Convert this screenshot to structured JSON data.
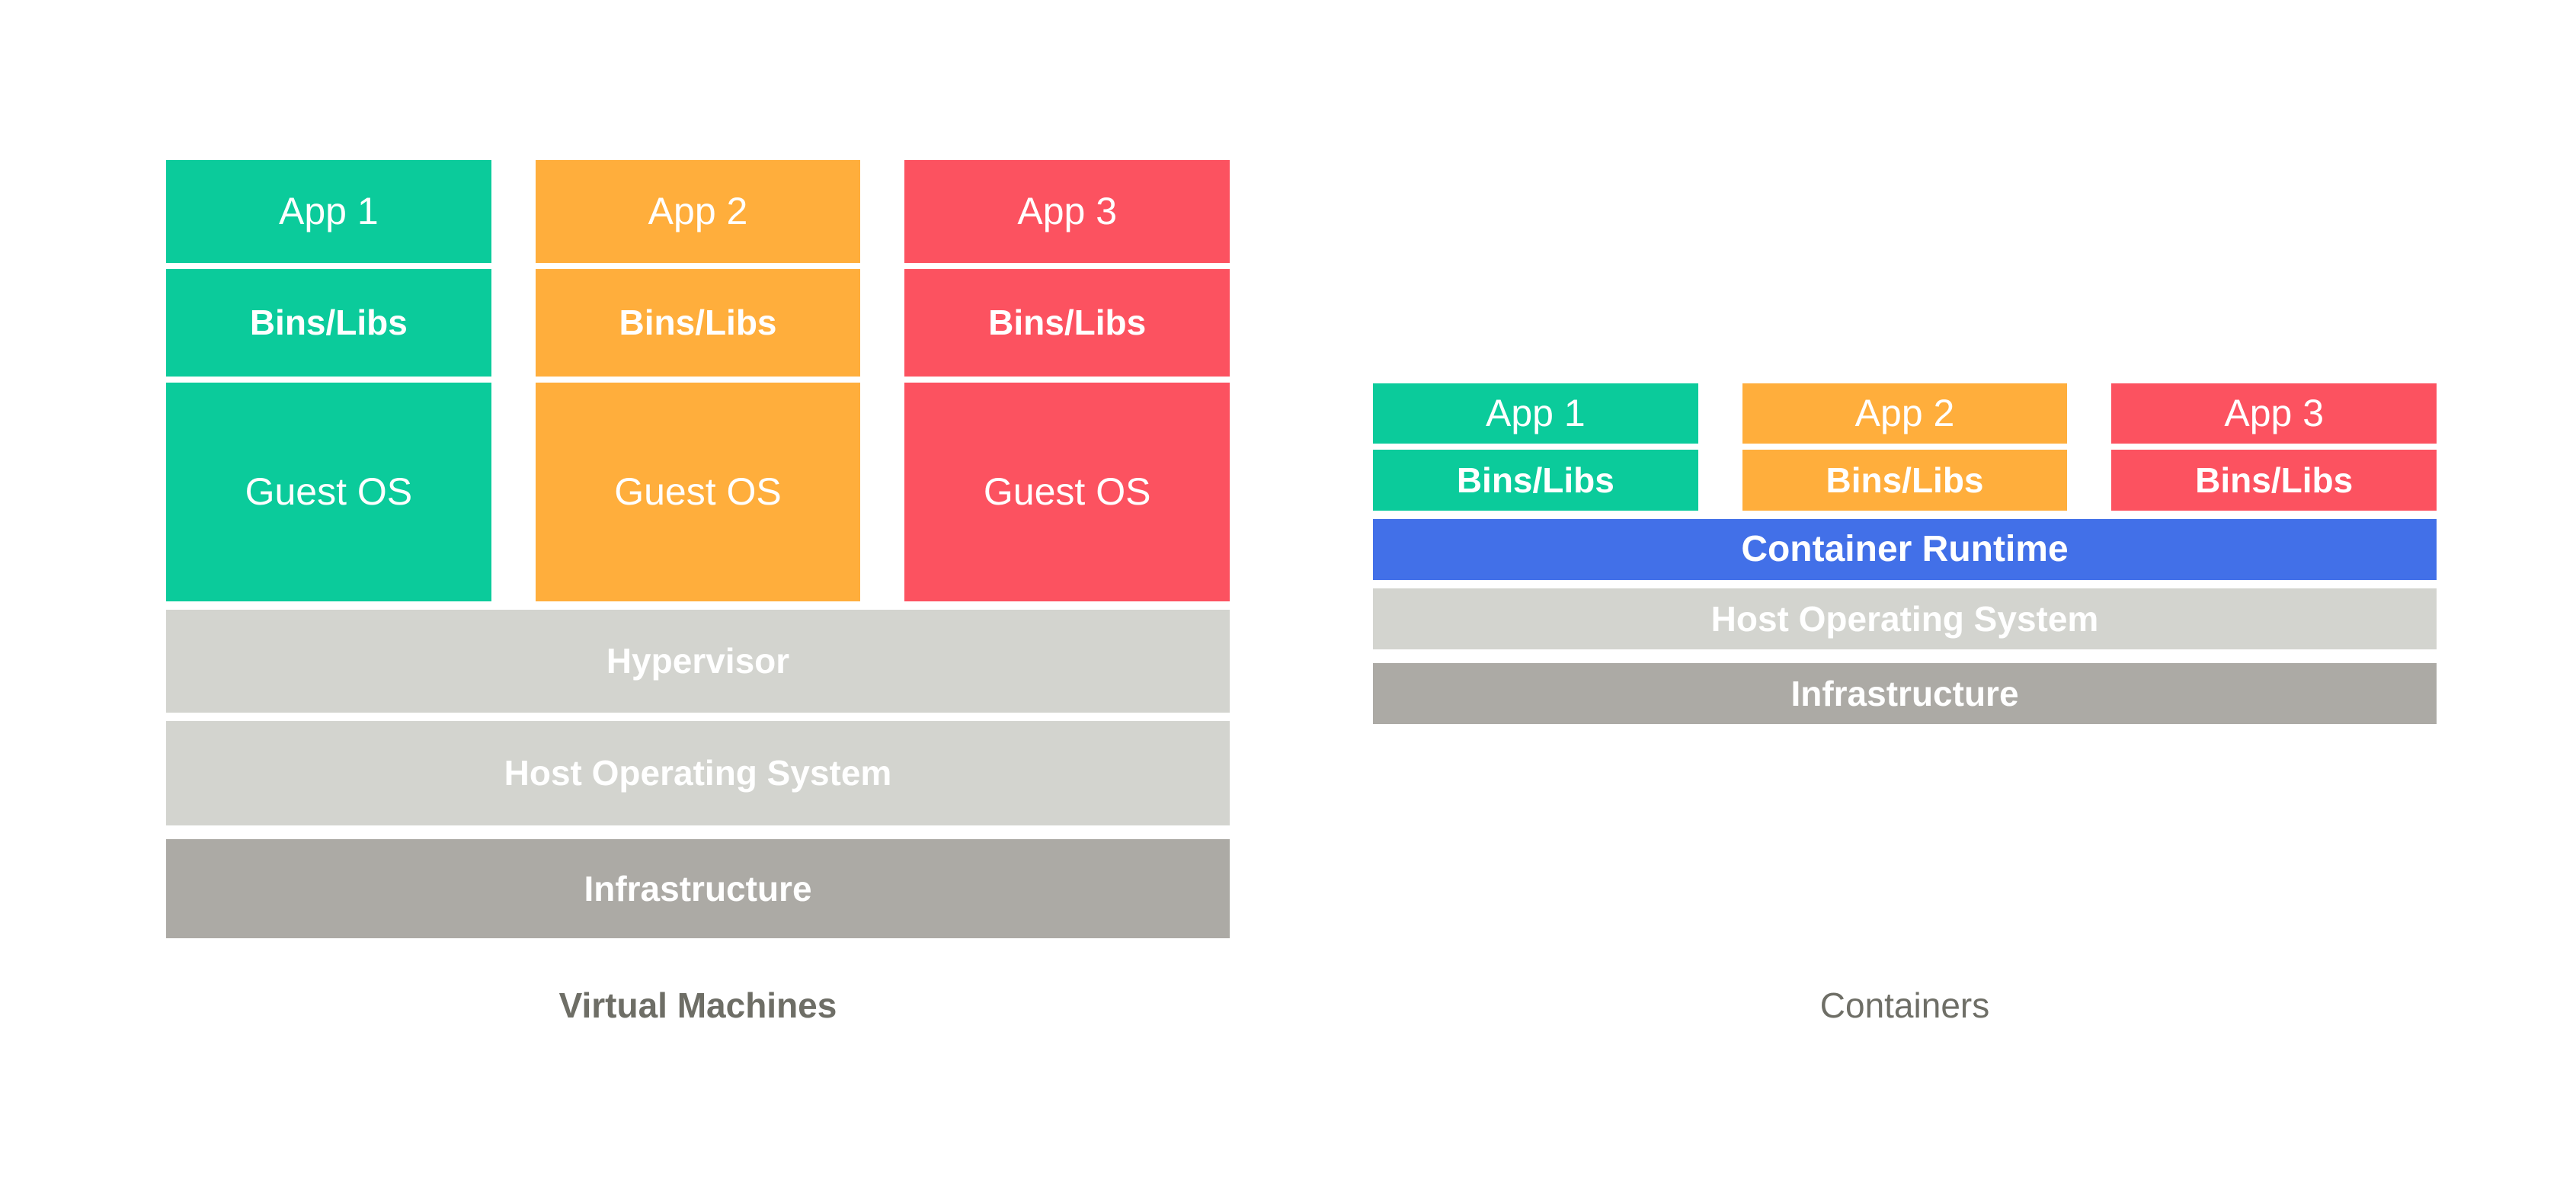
{
  "diagram": {
    "title_hidden": "",
    "palette": {
      "green": "#0BCB9B",
      "orange": "#FFAE3C",
      "red": "#FC5260",
      "blue": "#4270E8",
      "gray_light": "#D3D4CF",
      "gray_dark": "#ACAAA5",
      "text_on_fill": "#FFFFFF",
      "caption": "#6E6E66",
      "background": "#FFFFFF"
    }
  },
  "vm": {
    "caption": "Virtual Machines",
    "columns": [
      {
        "app": "App 1",
        "bins": "Bins/Libs",
        "guest": "Guest OS",
        "color": "#0BCB9B"
      },
      {
        "app": "App 2",
        "bins": "Bins/Libs",
        "guest": "Guest OS",
        "color": "#FFAE3C"
      },
      {
        "app": "App 3",
        "bins": "Bins/Libs",
        "guest": "Guest OS",
        "color": "#FC5260"
      }
    ],
    "layers": [
      {
        "label": "Hypervisor",
        "color": "#D3D4CF"
      },
      {
        "label": "Host Operating System",
        "color": "#D3D4CF"
      },
      {
        "label": "Infrastructure",
        "color": "#ACAAA5"
      }
    ]
  },
  "containers": {
    "caption": "Containers",
    "columns": [
      {
        "app": "App 1",
        "bins": "Bins/Libs",
        "color": "#0BCB9B"
      },
      {
        "app": "App 2",
        "bins": "Bins/Libs",
        "color": "#FFAE3C"
      },
      {
        "app": "App 3",
        "bins": "Bins/Libs",
        "color": "#FC5260"
      }
    ],
    "layers": [
      {
        "label": "Container Runtime",
        "color": "#4270E8"
      },
      {
        "label": "Host Operating System",
        "color": "#D3D4CF"
      },
      {
        "label": "Infrastructure",
        "color": "#ACAAA5"
      }
    ]
  }
}
